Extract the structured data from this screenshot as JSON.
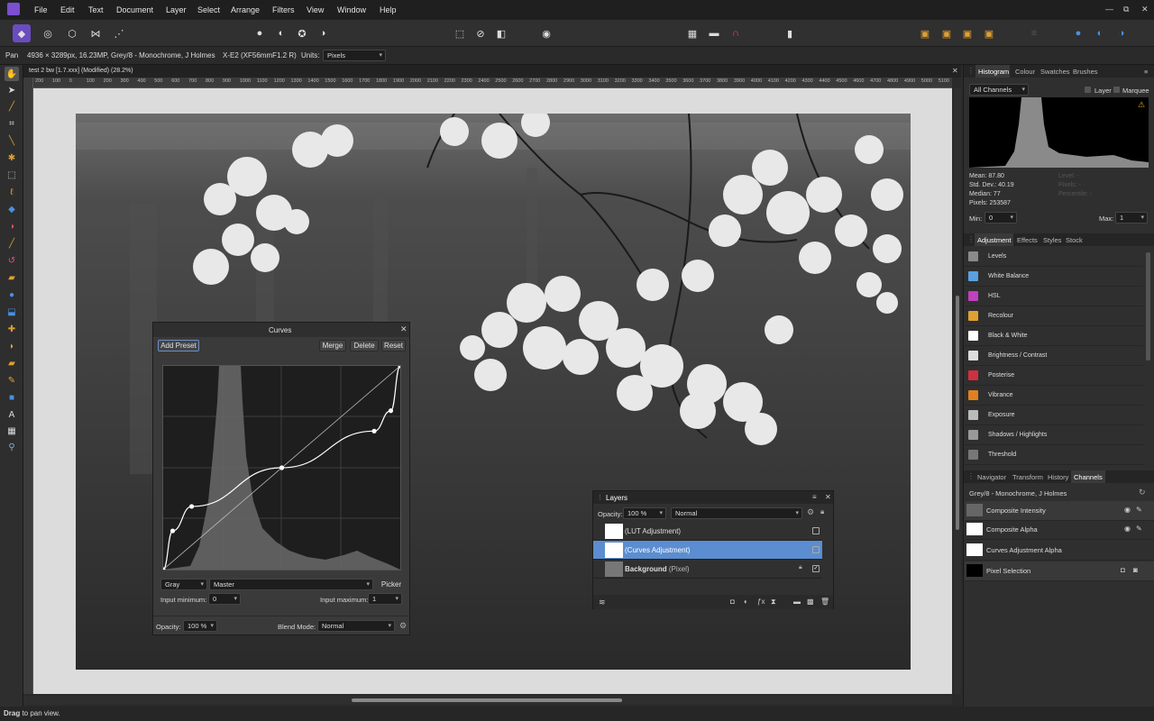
{
  "menu": {
    "items": [
      "File",
      "Edit",
      "Text",
      "Document",
      "Layer",
      "Select",
      "Arrange",
      "Filters",
      "View",
      "Window",
      "Help"
    ]
  },
  "window_controls": [
    "—",
    "⧉",
    "✕"
  ],
  "context": {
    "tool": "Pan",
    "info": "4936 × 3289px, 16.23MP, Grey/8 - Monochrome, J Holmes",
    "camera": "X-E2 (XF56mmF1.2 R)",
    "units_label": "Units:",
    "units_value": "Pixels"
  },
  "document": {
    "tab_title": "test 2 bw [1.7.xxx] (Modified) (28.2%)",
    "close": "✕"
  },
  "ruler": {
    "ticks": [
      "200",
      "100",
      "0",
      "100",
      "200",
      "300",
      "400",
      "500",
      "600",
      "700",
      "800",
      "900",
      "1000",
      "1100",
      "1200",
      "1300",
      "1400",
      "1500",
      "1600",
      "1700",
      "1800",
      "1900",
      "2000",
      "2100",
      "2200",
      "2300",
      "2400",
      "2500",
      "2600",
      "2700",
      "2800",
      "2900",
      "3000",
      "3100",
      "3200",
      "3300",
      "3400",
      "3500",
      "3600",
      "3700",
      "3800",
      "3900",
      "4000",
      "4100",
      "4200",
      "4300",
      "4400",
      "4500",
      "4600",
      "4700",
      "4800",
      "4900",
      "5000",
      "5100"
    ]
  },
  "curves": {
    "title": "Curves",
    "close": "✕",
    "add_preset": "Add Preset",
    "merge": "Merge",
    "delete": "Delete",
    "reset": "Reset",
    "channel_type": "Gray",
    "channel": "Master",
    "picker": "Picker",
    "input_min_label": "Input minimum:",
    "input_min": "0",
    "input_max_label": "Input maximum:",
    "input_max": "1",
    "opacity_label": "Opacity:",
    "opacity": "100 %",
    "blend_label": "Blend Mode:",
    "blend": "Normal",
    "points": [
      [
        0,
        0
      ],
      [
        0.04,
        0.19
      ],
      [
        0.12,
        0.31
      ],
      [
        0.5,
        0.5
      ],
      [
        0.89,
        0.68
      ],
      [
        0.96,
        0.78
      ],
      [
        1,
        1
      ]
    ]
  },
  "layers": {
    "title": "Layers",
    "opacity_label": "Opacity:",
    "opacity": "100 %",
    "blend": "Normal",
    "rows": [
      {
        "name": "(LUT Adjustment)",
        "selected": false
      },
      {
        "name": "(Curves Adjustment)",
        "selected": true
      },
      {
        "name": "Background",
        "suffix": " (Pixel)",
        "selected": false
      }
    ]
  },
  "histogram": {
    "tabs": [
      "Histogram",
      "Colour",
      "Swatches",
      "Brushes"
    ],
    "channels": "All Channels",
    "layer_label": "Layer",
    "marquee_label": "Marquee",
    "stats": [
      "Mean: 87.80",
      "Std. Dev.: 40.19",
      "Median: 77",
      "Pixels: 253587"
    ],
    "stats_right": [
      "Level: -",
      "Pixels: -",
      "Percentile: -"
    ],
    "min_label": "Min:",
    "min": "0",
    "max_label": "Max:",
    "max": "1"
  },
  "adjustment": {
    "tabs": [
      "Adjustment",
      "Effects",
      "Styles",
      "Stock"
    ],
    "items": [
      {
        "label": "Levels",
        "color": "#8a8a8a"
      },
      {
        "label": "White Balance",
        "color": "#5aa0e0"
      },
      {
        "label": "HSL",
        "color": "#c040c0"
      },
      {
        "label": "Recolour",
        "color": "#e0a030"
      },
      {
        "label": "Black & White",
        "color": "#ffffff"
      },
      {
        "label": "Brightness / Contrast",
        "color": "#dddddd"
      },
      {
        "label": "Posterise",
        "color": "#d03040"
      },
      {
        "label": "Vibrance",
        "color": "#e08020"
      },
      {
        "label": "Exposure",
        "color": "#bbbbbb"
      },
      {
        "label": "Shadows / Highlights",
        "color": "#999999"
      },
      {
        "label": "Threshold",
        "color": "#777777"
      }
    ]
  },
  "channels": {
    "tabs": [
      "Navigator",
      "Transform",
      "History",
      "Channels"
    ],
    "header": "Grey/8 - Monochrome, J Holmes",
    "rows": [
      {
        "label": "Composite Intensity",
        "thumb": "#666"
      },
      {
        "label": "Composite Alpha",
        "thumb": "#ffffff"
      },
      {
        "label": "Curves Adjustment Alpha",
        "thumb": "#ffffff"
      },
      {
        "label": "Pixel Selection",
        "thumb": "#000000"
      }
    ]
  },
  "status": {
    "bold": "Drag",
    "text": " to pan view."
  }
}
